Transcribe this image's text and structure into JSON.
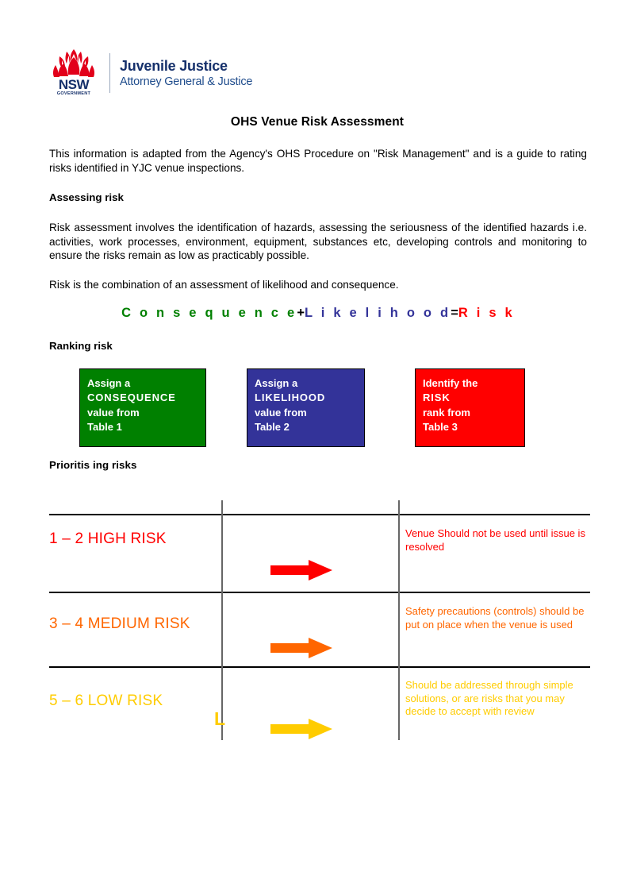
{
  "logo": {
    "mark_name": "nsw-waratah-logo",
    "wordmark": "NSW",
    "government": "GOVERNMENT",
    "line1": "Juvenile Justice",
    "line2": "Attorney General & Justice",
    "color_red": "#e2001a",
    "color_navy": "#15306b"
  },
  "document": {
    "title": "OHS Venue Risk Assessment",
    "intro": "This information  is adapted from the  Agency's OHS Procedure on \"Risk Management\" and is a guide to rating risks identified in YJC venue inspections.",
    "assessing_heading": "Assessing risk",
    "assessing_body": "Risk assessment  involves  the  identification  of hazards,  assessing  the  seriousness  of  the identified  hazards  i.e.  activities,  work  processes,  environment,   equipment,  substances  etc, developing controls and monitoring to ensure the risks remain as low as practicably possible.",
    "combination": "Risk is the combination of an assessment of likelihood and consequence.",
    "ranking_heading": "Ranking risk",
    "prioritising_heading": "Prioritis ing risks"
  },
  "equation": {
    "consequence": "C o n s e q u e n c e",
    "plus": "+",
    "likelihood": "L i k e l i h o o d",
    "equals": "=",
    "risk": "R i s k",
    "color_consequence": "#008000",
    "color_likelihood": "#333399",
    "color_risk": "#ff0000"
  },
  "ranking_boxes": [
    {
      "name": "consequence-box",
      "line1": "Assign a",
      "line2": "CONSEQUENCE",
      "line3": "value from",
      "line4": "Table  1",
      "color": "#008000"
    },
    {
      "name": "likelihood-box",
      "line1": "Assign a",
      "line2": "LIKELIHOOD",
      "line3": "value from",
      "line4": "Table 2",
      "color": "#333399"
    },
    {
      "name": "risk-box",
      "line1": "Identify the",
      "line2": "RISK",
      "line3": "rank from",
      "line4": "Table 3",
      "color": "#ff0000"
    }
  ],
  "priority_table": {
    "rows": [
      {
        "label": "1 – 2 HIGH RISK",
        "description": "Venue Should not be used until issue is resolved",
        "arrow": "right-arrow-icon",
        "color": "#ff0000"
      },
      {
        "label": "3 – 4 MEDIUM RISK",
        "description": "Safety precautions (controls) should be put on place when the venue is used",
        "arrow": "right-arrow-icon",
        "color": "#ff6600"
      },
      {
        "label": "5 – 6 LOW RISK",
        "description": "Should be addressed through simple solutions, or are risks that you may decide to accept with review",
        "arrow": "right-arrow-icon",
        "color": "#ffcc00"
      }
    ],
    "stray_glyph": "L"
  }
}
